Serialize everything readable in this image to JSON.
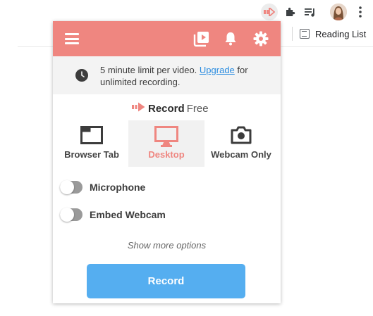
{
  "browser": {
    "reading_list_label": "Reading List"
  },
  "popup": {
    "notice": {
      "text_before": "5 minute limit per video. ",
      "link_label": "Upgrade",
      "text_after": " for unlimited recording."
    },
    "logo": {
      "name": "Record",
      "suffix": "Free"
    },
    "modes": [
      {
        "label": "Browser Tab",
        "icon": "browser-tab-icon",
        "selected": false
      },
      {
        "label": "Desktop",
        "icon": "desktop-monitor-icon",
        "selected": true
      },
      {
        "label": "Webcam Only",
        "icon": "camera-icon",
        "selected": false
      }
    ],
    "toggles": [
      {
        "label": "Microphone",
        "on": false
      },
      {
        "label": "Embed Webcam",
        "on": false
      }
    ],
    "more_options_label": "Show more options",
    "record_label": "Record"
  },
  "colors": {
    "header": "#ef8680",
    "accent": "#ef8680",
    "record_button": "#55aef0",
    "link": "#2a8ce0",
    "selected_mode_bg": "#f1f1f1"
  }
}
